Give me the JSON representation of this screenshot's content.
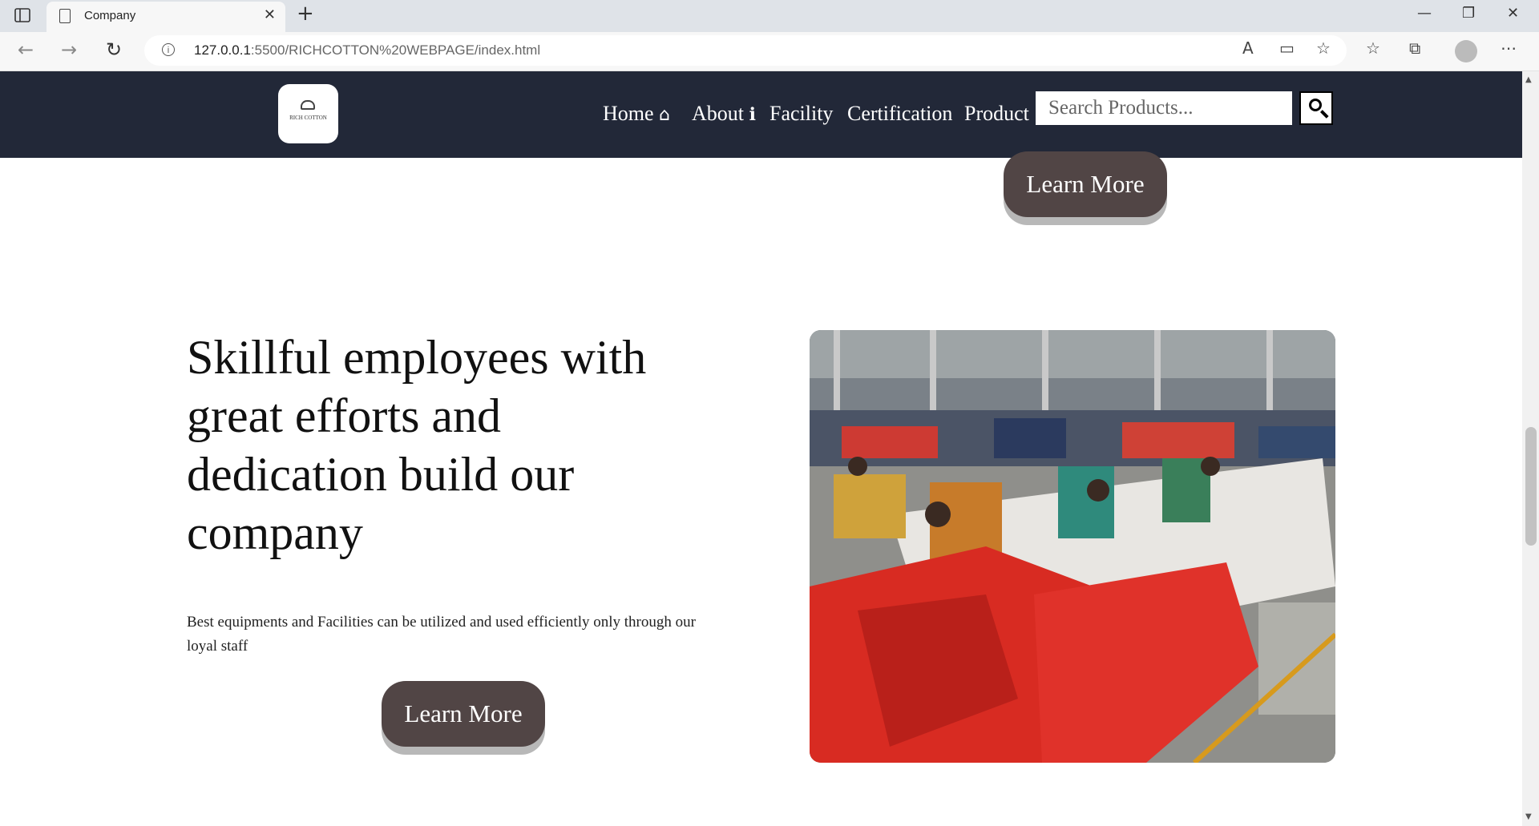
{
  "browser": {
    "tab_title": "Company",
    "close_glyph": "✕",
    "new_tab_glyph": "+",
    "url_host": "127.0.0.1",
    "url_rest": ":5500/RICHCOTTON%20WEBPAGE/index.html",
    "controls": {
      "minimize": "—",
      "maximize": "❐",
      "close": "✕"
    },
    "nav": {
      "back": "←",
      "forward": "→",
      "reload": "↻"
    },
    "toolbar_icons": {
      "read_aloud": "A",
      "immersive": "▭",
      "add_favorite": "☆",
      "favorites": "☆",
      "collections": "⧉",
      "more": "⋯"
    }
  },
  "site": {
    "logo_text": "RICH COTTON",
    "nav": [
      {
        "label": "Home",
        "icon": "home-icon",
        "glyph": "⌂"
      },
      {
        "label": "About",
        "icon": "info-icon",
        "glyph": "ℹ"
      },
      {
        "label": "Facility"
      },
      {
        "label": "Certification"
      },
      {
        "label": "Product"
      }
    ],
    "search": {
      "placeholder": "Search Products..."
    },
    "top_button": "Learn More",
    "section": {
      "headline": "Skillful employees with great efforts and dedication build our company",
      "body": "Best equipments and Facilities can be utilized and used efficiently only through our loyal staff",
      "button": "Learn More"
    }
  },
  "colors": {
    "navbar": "#222838",
    "button": "#514545",
    "button_shadow": "#b8b8b8"
  }
}
